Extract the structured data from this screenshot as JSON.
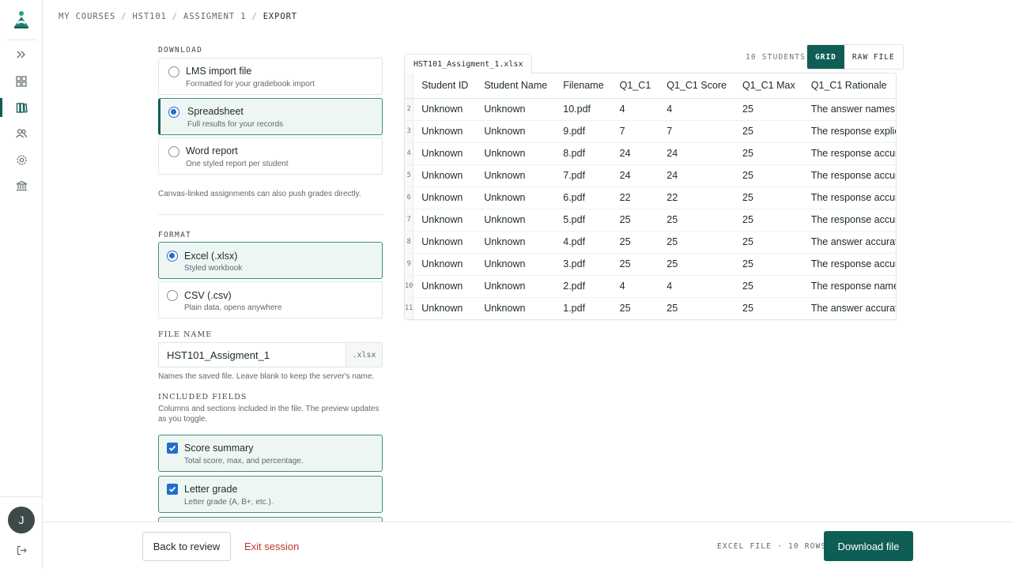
{
  "breadcrumb": [
    "MY COURSES",
    "HST101",
    "ASSIGMENT 1",
    "EXPORT"
  ],
  "sidebar": {
    "items": [
      {
        "icon": "expand-icon"
      },
      {
        "icon": "dashboard-icon"
      },
      {
        "icon": "courses-icon",
        "active": true
      },
      {
        "icon": "users-icon"
      },
      {
        "icon": "settings-icon"
      },
      {
        "icon": "institution-icon"
      }
    ],
    "avatar_initial": "J"
  },
  "download": {
    "label": "DOWNLOAD",
    "options": [
      {
        "title": "LMS import file",
        "subtitle": "Formatted for your gradebook import",
        "selected": false
      },
      {
        "title": "Spreadsheet",
        "subtitle": "Full results for your records",
        "selected": true
      },
      {
        "title": "Word report",
        "subtitle": "One styled report per student",
        "selected": false
      }
    ],
    "note": "Canvas-linked assignments can also push grades directly."
  },
  "format": {
    "label": "FORMAT",
    "options": [
      {
        "title": "Excel (.xlsx)",
        "subtitle": "Styled workbook",
        "selected": true
      },
      {
        "title": "CSV (.csv)",
        "subtitle": "Plain data, opens anywhere",
        "selected": false
      }
    ]
  },
  "file_name": {
    "label": "FILE NAME",
    "value": "HST101_Assigment_1",
    "extension": ".xlsx",
    "hint": "Names the saved file. Leave blank to keep the server's name."
  },
  "included_fields": {
    "label": "INCLUDED FIELDS",
    "description": "Columns and sections included in the file. The preview updates as you toggle.",
    "items": [
      {
        "title": "Score summary",
        "subtitle": "Total score, max, and percentage.",
        "checked": true
      },
      {
        "title": "Letter grade",
        "subtitle": "Letter grade (A, B+, etc.).",
        "checked": true
      }
    ]
  },
  "preview": {
    "file_tab": "HST101_Assigment_1.xlsx",
    "student_count": "10 STUDENTS",
    "view_grid": "GRID",
    "view_raw": "RAW FILE",
    "columns": [
      "Student ID",
      "Student Name",
      "Filename",
      "Q1_C1",
      "Q1_C1 Score",
      "Q1_C1 Max",
      "Q1_C1 Rationale"
    ],
    "rows": [
      [
        "2",
        "Unknown",
        "Unknown",
        "10.pdf",
        "4",
        "4",
        "25",
        "The answer names milita"
      ],
      [
        "3",
        "Unknown",
        "Unknown",
        "9.pdf",
        "7",
        "7",
        "25",
        "The response explicitly na"
      ],
      [
        "4",
        "Unknown",
        "Unknown",
        "8.pdf",
        "24",
        "24",
        "25",
        "The response accurately"
      ],
      [
        "5",
        "Unknown",
        "Unknown",
        "7.pdf",
        "24",
        "24",
        "25",
        "The response accurately"
      ],
      [
        "6",
        "Unknown",
        "Unknown",
        "6.pdf",
        "22",
        "22",
        "25",
        "The response accurately"
      ],
      [
        "7",
        "Unknown",
        "Unknown",
        "5.pdf",
        "25",
        "25",
        "25",
        "The response accurately"
      ],
      [
        "8",
        "Unknown",
        "Unknown",
        "4.pdf",
        "25",
        "25",
        "25",
        "The answer accurately id"
      ],
      [
        "9",
        "Unknown",
        "Unknown",
        "3.pdf",
        "25",
        "25",
        "25",
        "The response accurately"
      ],
      [
        "10",
        "Unknown",
        "Unknown",
        "2.pdf",
        "4",
        "4",
        "25",
        "The response names the"
      ],
      [
        "11",
        "Unknown",
        "Unknown",
        "1.pdf",
        "25",
        "25",
        "25",
        "The answer accurately id"
      ]
    ]
  },
  "footer": {
    "back_label": "Back to review",
    "exit_label": "Exit session",
    "file_meta": "EXCEL FILE · 10 ROWS",
    "download_label": "Download file"
  },
  "colors": {
    "accent": "#0f5e55",
    "radio_blue": "#1f6fd0",
    "danger": "#c0392b"
  }
}
